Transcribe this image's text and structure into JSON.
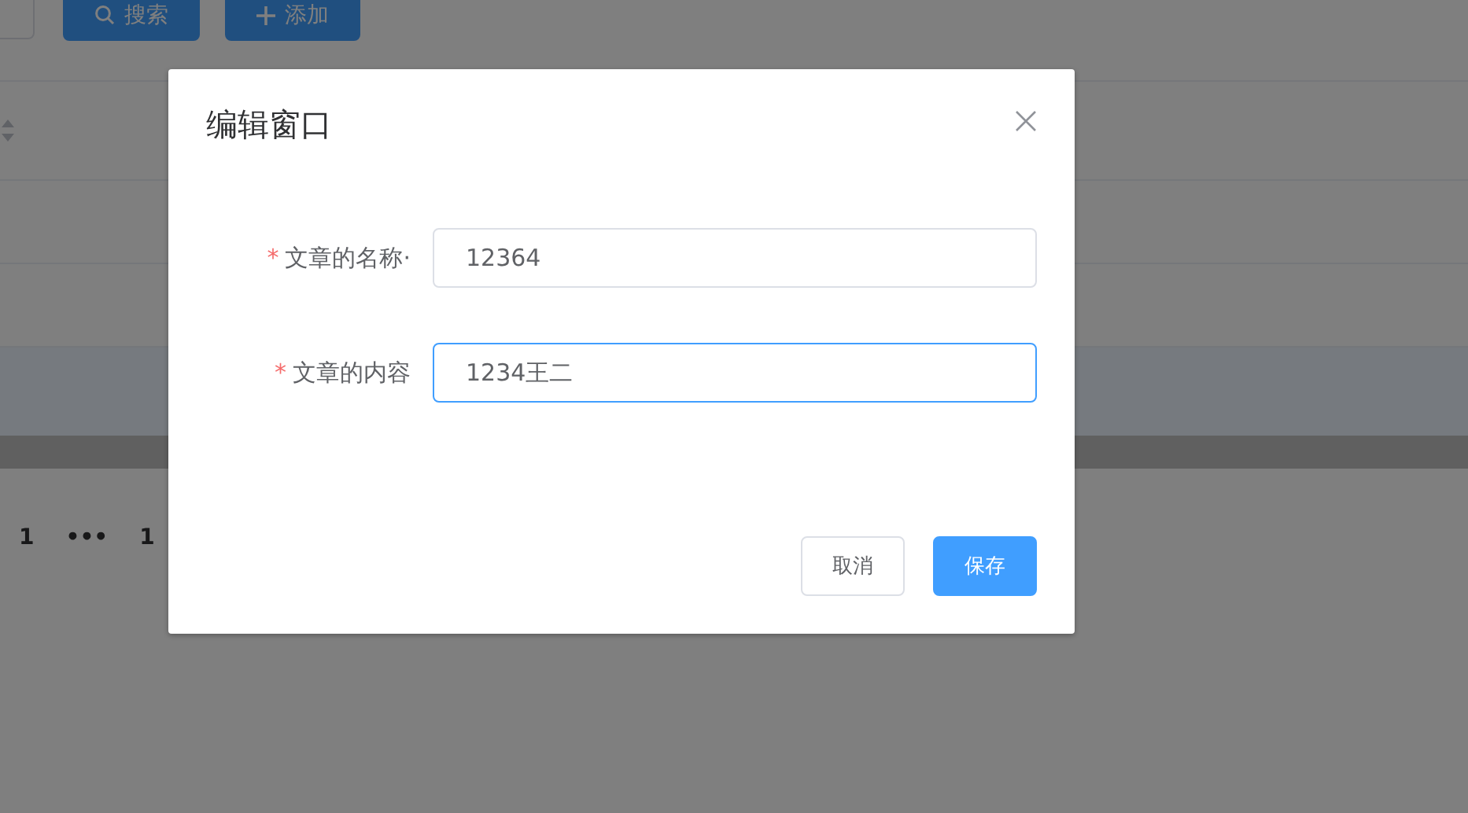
{
  "toolbar": {
    "buttons": [
      {
        "kind": "search",
        "label": "搜索"
      },
      {
        "kind": "add",
        "label": "添加"
      }
    ]
  },
  "table": {
    "rows": [
      {
        "selected": false
      },
      {
        "selected": false
      },
      {
        "selected": true
      }
    ]
  },
  "pagination": [
    "1",
    "•••",
    "1"
  ],
  "dialog": {
    "title": "编辑窗口",
    "fields": [
      {
        "required_mark": "*",
        "label": "文章的名称·",
        "value": "12364",
        "focused": false
      },
      {
        "required_mark": "*",
        "label": "文章的内容",
        "value": "1234王二",
        "focused": true
      }
    ],
    "buttons": [
      {
        "label": "取消",
        "primary": false
      },
      {
        "label": "保存",
        "primary": true
      }
    ]
  }
}
